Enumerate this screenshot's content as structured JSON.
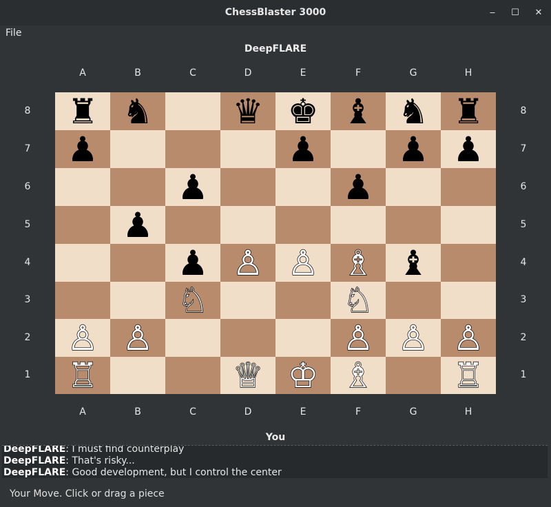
{
  "window": {
    "title": "ChessBlaster 3000",
    "minimize": "‒",
    "maximize": "☐",
    "close": "✕"
  },
  "menu": {
    "file": "File"
  },
  "players": {
    "top": "DeepFLARE",
    "bottom": "You"
  },
  "files": [
    "A",
    "B",
    "C",
    "D",
    "E",
    "F",
    "G",
    "H"
  ],
  "ranks": [
    "8",
    "7",
    "6",
    "5",
    "4",
    "3",
    "2",
    "1"
  ],
  "board": [
    [
      "♜",
      "♞",
      "",
      "♛",
      "♚",
      "♝",
      "♞",
      "♜"
    ],
    [
      "♟",
      "",
      "",
      "",
      "♟",
      "",
      "♟",
      "♟"
    ],
    [
      "",
      "",
      "♟",
      "",
      "",
      "♟",
      "",
      ""
    ],
    [
      "",
      "♟",
      "",
      "",
      "",
      "",
      "",
      ""
    ],
    [
      "",
      "",
      "♟",
      "♙",
      "♙",
      "♗",
      "♝",
      ""
    ],
    [
      "",
      "",
      "♘",
      "",
      "",
      "♘",
      "",
      ""
    ],
    [
      "♙",
      "♙",
      "",
      "",
      "",
      "♙",
      "♙",
      "♙"
    ],
    [
      "♖",
      "",
      "",
      "♕",
      "♔",
      "♗",
      "",
      "♖"
    ]
  ],
  "chat": [
    {
      "speaker": "DeepFLARE",
      "text": ": I must find counterplay"
    },
    {
      "speaker": "DeepFLARE",
      "text": ": That's risky..."
    },
    {
      "speaker": "DeepFLARE",
      "text": ": Good development, but I control the center"
    }
  ],
  "status": "Your Move. Click or drag a piece",
  "colors": {
    "light_square": "#f1dec8",
    "dark_square": "#b88b6d",
    "background": "#313437"
  }
}
